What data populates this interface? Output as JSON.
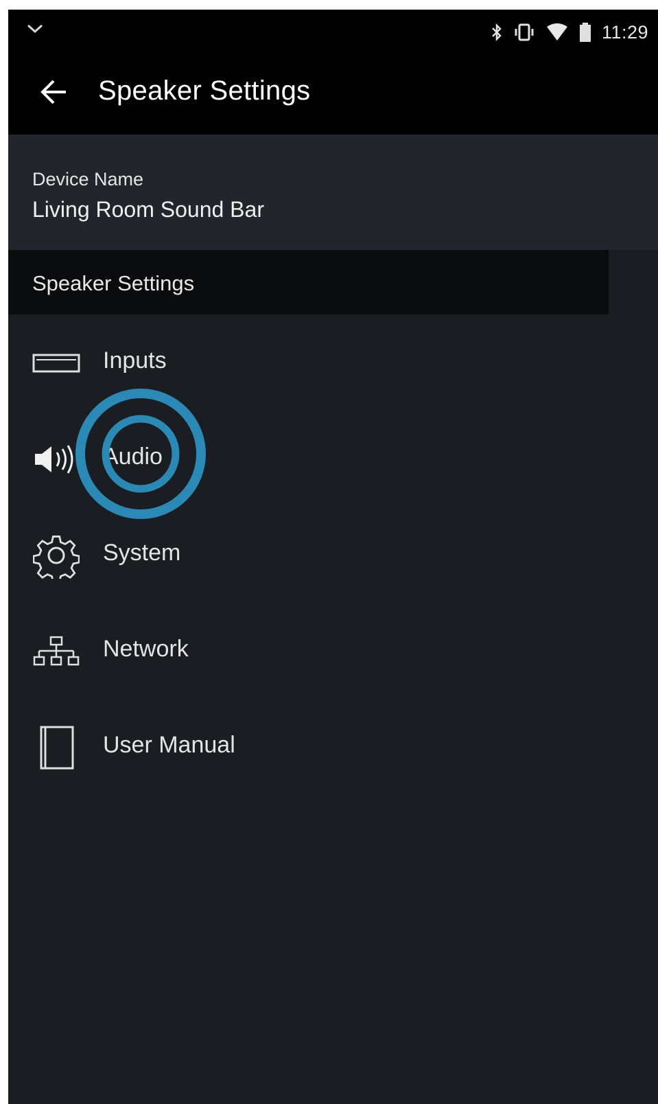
{
  "status_bar": {
    "time": "11:29",
    "icons": [
      "bluetooth-icon",
      "vibrate-icon",
      "wifi-icon",
      "battery-icon"
    ],
    "left_icon": "notification-chevron-icon"
  },
  "app_bar": {
    "title": "Speaker Settings",
    "back_icon": "arrow-back-icon"
  },
  "device": {
    "label": "Device Name",
    "value": "Living Room Sound Bar"
  },
  "section": {
    "header": "Speaker Settings"
  },
  "menu": {
    "items": [
      {
        "label": "Inputs",
        "icon": "inputs-icon"
      },
      {
        "label": "Audio",
        "icon": "speaker-icon"
      },
      {
        "label": "System",
        "icon": "gear-icon"
      },
      {
        "label": "Network",
        "icon": "network-icon"
      },
      {
        "label": "User Manual",
        "icon": "manual-icon"
      }
    ]
  },
  "colors": {
    "background": "#1a1d22",
    "app_bar": "#000000",
    "tap_indicator": "#2b8ab5"
  }
}
